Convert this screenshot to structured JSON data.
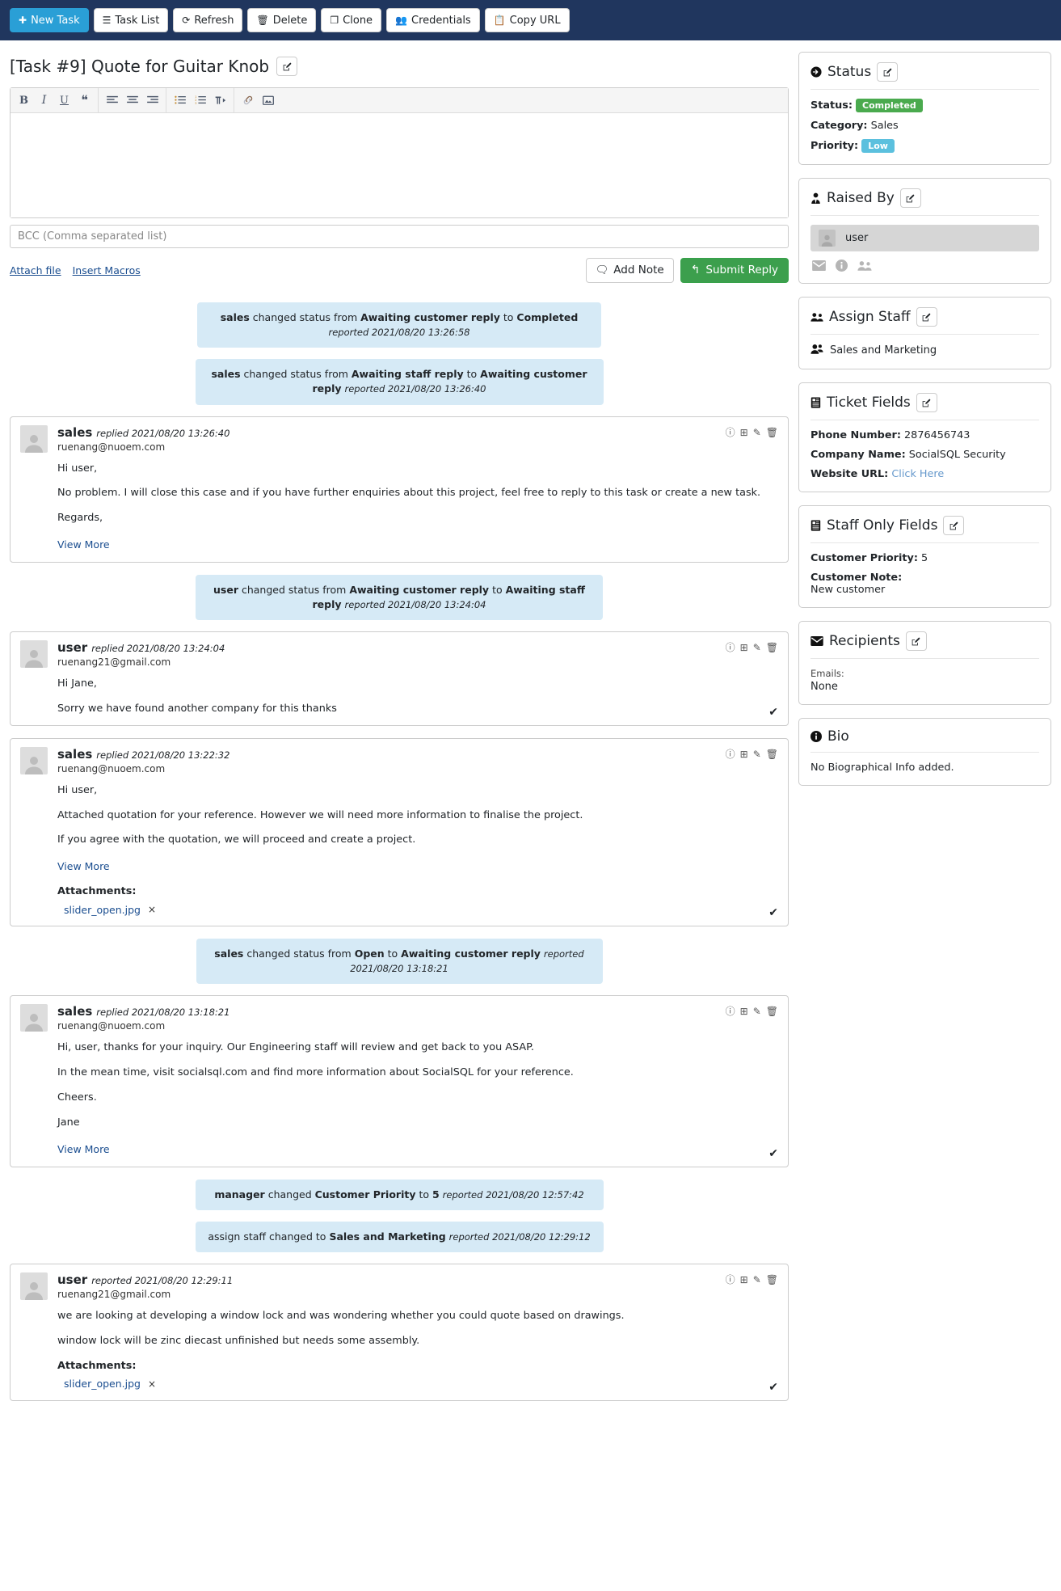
{
  "toolbar": {
    "buttons": [
      {
        "label": "New Task",
        "icon": "plus-icon",
        "style": "primary"
      },
      {
        "label": "Task List",
        "icon": "list-icon",
        "style": "default"
      },
      {
        "label": "Refresh",
        "icon": "refresh-icon",
        "style": "default"
      },
      {
        "label": "Delete",
        "icon": "trash-icon",
        "style": "default"
      },
      {
        "label": "Clone",
        "icon": "copy-icon",
        "style": "default"
      },
      {
        "label": "Credentials",
        "icon": "users-key-icon",
        "style": "default"
      },
      {
        "label": "Copy URL",
        "icon": "clipboard-icon",
        "style": "default"
      }
    ]
  },
  "page_title": "[Task #9] Quote for Guitar Knob",
  "editor": {
    "tools": [
      "bold-icon",
      "italic-icon",
      "underline-icon",
      "blockquote-icon",
      "align-left-icon",
      "align-center-icon",
      "align-right-icon",
      "unordered-list-icon",
      "ordered-list-icon",
      "rtl-paragraph-icon",
      "link-icon",
      "image-icon"
    ],
    "content": "",
    "bcc_placeholder": "BCC (Comma separated list)",
    "bcc_value": "",
    "attach_file_label": "Attach file",
    "insert_macros_label": "Insert Macros",
    "add_note_label": "Add Note",
    "submit_reply_label": "Submit Reply"
  },
  "thread": [
    {
      "kind": "status",
      "actor": "sales",
      "text_before": " changed status from ",
      "from": "Awaiting customer reply",
      "mid": " to ",
      "to": "Completed",
      "reported": "reported 2021/08/20 13:26:58"
    },
    {
      "kind": "status",
      "actor": "sales",
      "text_before": " changed status from ",
      "from": "Awaiting staff reply",
      "mid": " to ",
      "to": "Awaiting customer reply",
      "reported": "reported 2021/08/20 13:26:40"
    },
    {
      "kind": "message",
      "name": "sales",
      "when": "replied 2021/08/20 13:26:40",
      "email": "ruenang@nuoem.com",
      "paragraphs": [
        "Hi user,",
        "No problem. I will close this case and if you have further enquiries about this project, feel free to reply to this task or create a new task.",
        "Regards,"
      ],
      "view_more": "View More",
      "attachments_label": "",
      "attachments": [],
      "verified": false
    },
    {
      "kind": "status",
      "actor": "user",
      "text_before": " changed status from ",
      "from": "Awaiting customer reply",
      "mid": " to ",
      "to": "Awaiting staff reply",
      "reported": "reported 2021/08/20 13:24:04"
    },
    {
      "kind": "message",
      "name": "user",
      "when": "replied 2021/08/20 13:24:04",
      "email": "ruenang21@gmail.com",
      "paragraphs": [
        "Hi Jane,",
        "Sorry we have found another company for this thanks"
      ],
      "view_more": "",
      "attachments_label": "",
      "attachments": [],
      "verified": true
    },
    {
      "kind": "message",
      "name": "sales",
      "when": "replied 2021/08/20 13:22:32",
      "email": "ruenang@nuoem.com",
      "paragraphs": [
        "Hi user,",
        "Attached quotation for your reference. However we will need more information to finalise the project.",
        "If you agree with the quotation, we will proceed and create a project."
      ],
      "view_more": "View More",
      "attachments_label": "Attachments:",
      "attachments": [
        {
          "name": "slider_open.jpg",
          "remove": "×"
        }
      ],
      "verified": true
    },
    {
      "kind": "status",
      "actor": "sales",
      "text_before": " changed status from ",
      "from": "Open",
      "mid": " to ",
      "to": "Awaiting customer reply",
      "reported": "reported 2021/08/20 13:18:21"
    },
    {
      "kind": "message",
      "name": "sales",
      "when": "replied 2021/08/20 13:18:21",
      "email": "ruenang@nuoem.com",
      "paragraphs": [
        "Hi, user, thanks for your inquiry. Our Engineering staff will review and get back to you ASAP.",
        "In the mean time,  visit socialsql.com and find more information about SocialSQL for your reference.",
        "Cheers.",
        "Jane"
      ],
      "view_more": "View More",
      "attachments_label": "",
      "attachments": [],
      "verified": true
    },
    {
      "kind": "status_plain",
      "actor": "manager",
      "text_before": " changed ",
      "from": "Customer Priority",
      "mid": " to ",
      "to": "5",
      "reported": "reported 2021/08/20 12:57:42"
    },
    {
      "kind": "status_assign",
      "actor": "",
      "text_before": "assign staff changed to ",
      "from": "",
      "mid": "",
      "to": "Sales and Marketing",
      "reported": "reported 2021/08/20 12:29:12"
    },
    {
      "kind": "message",
      "name": "user",
      "when": "reported 2021/08/20 12:29:11",
      "email": "ruenang21@gmail.com",
      "paragraphs": [
        "we are looking at developing a window lock and was wondering whether you could quote based on drawings.",
        "window lock will be zinc diecast unfinished but needs some assembly."
      ],
      "view_more": "",
      "attachments_label": "Attachments:",
      "attachments": [
        {
          "name": "slider_open.jpg",
          "remove": "×"
        }
      ],
      "verified": true
    }
  ],
  "sidebar": {
    "status_panel": {
      "title": "Status",
      "icon": "arrow-circle-right-icon",
      "status_label": "Status:",
      "status_value": "Completed",
      "status_color": "#4aaa4e",
      "category_label": "Category:",
      "category_value": "Sales",
      "priority_label": "Priority:",
      "priority_value": "Low",
      "priority_color": "#5bc0de"
    },
    "raised_by": {
      "title": "Raised By",
      "icon": "user-tie-icon",
      "user": "user",
      "icons": [
        "envelope-icon",
        "info-circle-icon",
        "users-icon"
      ]
    },
    "assign_staff": {
      "title": "Assign Staff",
      "icon": "users-icon",
      "value": "Sales and Marketing"
    },
    "ticket_fields": {
      "title": "Ticket Fields",
      "icon": "form-icon",
      "rows": [
        {
          "label": "Phone Number:",
          "value": "2876456743",
          "is_link": false
        },
        {
          "label": "Company Name:",
          "value": "SocialSQL Security",
          "is_link": false
        },
        {
          "label": "Website URL:",
          "value": "Click Here",
          "is_link": true
        }
      ]
    },
    "staff_only_fields": {
      "title": "Staff Only Fields",
      "icon": "form-icon",
      "priority_label": "Customer Priority:",
      "priority_value": "5",
      "note_label": "Customer Note:",
      "note_value": "New customer"
    },
    "recipients": {
      "title": "Recipients",
      "icon": "envelope-icon",
      "emails_label": "Emails:",
      "emails_value": "None"
    },
    "bio": {
      "title": "Bio",
      "icon": "info-circle-icon",
      "text": "No Biographical Info added."
    }
  }
}
